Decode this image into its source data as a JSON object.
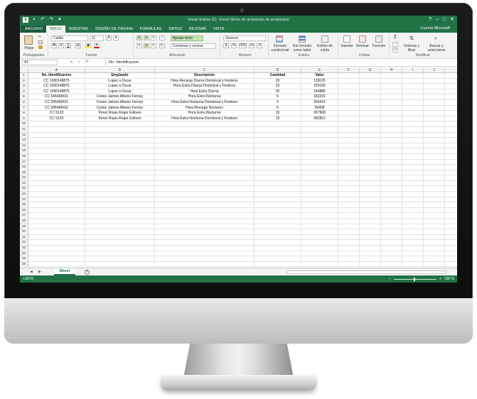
{
  "window": {
    "title": "Horas Extras (1) - Excel (Error de activación de productos)",
    "account": "Cuenta Microsoft",
    "qat_icons": [
      "excel-logo-icon",
      "save-icon",
      "undo-icon",
      "redo-icon",
      "customize-icon"
    ]
  },
  "tabs": [
    "ARCHIVO",
    "INICIO",
    "INSERTAR",
    "DISEÑO DE PÁGINA",
    "FÓRMULAS",
    "DATOS",
    "REVISAR",
    "VISTA"
  ],
  "ribbon": {
    "paste": "Pegar",
    "font_name": "Calibri",
    "font_size": "11",
    "bold": "N",
    "italic": "K",
    "underline": "S",
    "wrap_text": "Ajustar texto",
    "merge_center": "Combinar y centrar",
    "number_format": "General",
    "currency": "$",
    "percent": "%",
    "thousands": "000",
    "dec_increase": "+0",
    "dec_decrease": "-0",
    "conditional_format": "Formato condicional",
    "format_table": "Dar formato como tabla",
    "cell_styles": "Estilos de celda",
    "insert": "Insertar",
    "delete": "Eliminar",
    "format": "Formato",
    "sort_filter": "Ordenar y filtrar",
    "find_select": "Buscar y seleccionar",
    "groups": [
      "Portapapeles",
      "Fuente",
      "Alineación",
      "Número",
      "Estilos",
      "Celdas",
      "Modificar"
    ]
  },
  "formula_bar": {
    "name_box": "A1",
    "cancel": "✕",
    "enter": "✓",
    "fx": "fx",
    "content": "No. Identificacion"
  },
  "columns": [
    "A",
    "B",
    "C",
    "D",
    "E",
    "F",
    "G",
    "H",
    "I",
    "J"
  ],
  "table": {
    "headers": [
      "No. Identificacion",
      "Empleado",
      "Descripción",
      "Cantidad",
      "Valor"
    ],
    "rows": [
      [
        "CC 1000148875",
        "Lopez  a Oscar",
        "Hora Recargo Diurno Dominical y Festivos",
        "20",
        "115625"
      ],
      [
        "CC 1000148875",
        "Lopez  a Oscar",
        "Hora Extra Diurna Dominical y Festivos",
        "10",
        "154166"
      ],
      [
        "CC 1000148875",
        "Lopez  a Oscar",
        "Hora Extra Diurna",
        "25",
        "240885"
      ],
      [
        "CC 545468411",
        "Cortes  Jaimes Albeiro  Ferney",
        "Hora Extra Nocturna",
        "5",
        "182291"
      ],
      [
        "CC 545468411",
        "Cortes  Jaimes Albeiro  Ferney",
        "Hora Extra Nocturna Dominical y Festivos",
        "5",
        "260416"
      ],
      [
        "CC 545468411",
        "Cortes  Jaimes Albeiro  Ferney",
        "Hora Recargo Nocturno",
        "5",
        "36458"
      ],
      [
        "CC 5120",
        "Perez  Rojas Roger  Estiven",
        "Hora Extra Nocturna",
        "15",
        "267968"
      ],
      [
        "CC 5120",
        "Perez  Rojas Roger  Estiven",
        "Hora Extra Nocturna Dominical y Festivos",
        "15",
        "382812"
      ]
    ]
  },
  "row_numbers": [
    "1",
    "2",
    "3",
    "4",
    "5",
    "6",
    "7",
    "8",
    "9",
    "10",
    "11",
    "12",
    "13",
    "14",
    "15",
    "16",
    "17",
    "18",
    "19",
    "20",
    "21",
    "22",
    "23",
    "24",
    "25",
    "26",
    "27",
    "28",
    "29",
    "30",
    "31",
    "32",
    "33",
    "34",
    "35",
    "36"
  ],
  "sheet": {
    "tab_name": "Sheet",
    "add": "+",
    "nav_prev": "◀",
    "nav_next": "▶"
  },
  "status": {
    "text": "LISTO",
    "zoom": "100 %",
    "zoom_out": "−",
    "zoom_in": "+"
  },
  "colors": {
    "excel_green": "#217346",
    "ribbon_bg": "#f3f3f3"
  }
}
